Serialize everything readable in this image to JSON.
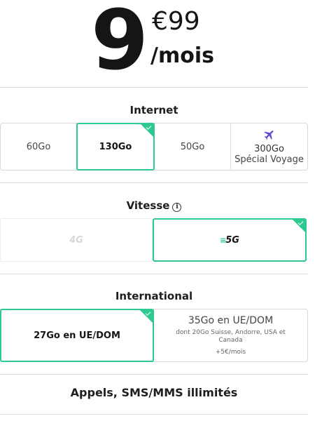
{
  "price": {
    "integer": "9",
    "decimal": "€99",
    "unit": "/mois"
  },
  "internet": {
    "title": "Internet",
    "options": [
      {
        "label": "60Go",
        "selected": false
      },
      {
        "label": "130Go",
        "selected": true
      },
      {
        "label": "50Go",
        "selected": false
      },
      {
        "label": "300Go",
        "sublabel": "Spécial Voyage",
        "icon": "plane-icon",
        "selected": false
      }
    ]
  },
  "speed": {
    "title": "Vitesse",
    "info_icon": "i",
    "options": [
      {
        "label": "4G",
        "selected": false,
        "disabled": true
      },
      {
        "label": "5G",
        "selected": true
      }
    ]
  },
  "international": {
    "title": "International",
    "options": [
      {
        "label": "27Go en UE/DOM",
        "selected": true
      },
      {
        "label": "35Go en UE/DOM",
        "detail": "dont 20Go Suisse, Andorre, USA et Canada",
        "extra": "+5€/mois",
        "selected": false
      }
    ]
  },
  "calls": {
    "label": "Appels, SMS/MMS illimités"
  },
  "colors": {
    "accent": "#2ec990",
    "text": "#1e1e1e",
    "border": "#d9d9d9",
    "plane": "#5b4bd8"
  }
}
